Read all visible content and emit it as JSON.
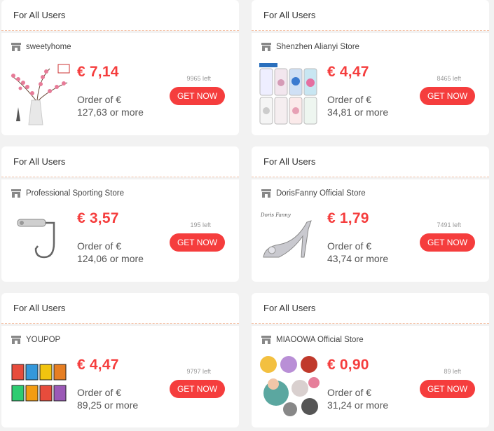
{
  "coupons": [
    {
      "header": "For All Users",
      "store": "sweetyhome",
      "price": "€ 7,14",
      "order_line1": "Order of €",
      "order_line2": "127,63 or more",
      "left": "9965 left",
      "button": "GET NOW",
      "image_icon": "flower-vase-image"
    },
    {
      "header": "For All Users",
      "store": "Shenzhen Alianyi Store",
      "price": "€ 4,47",
      "order_line1": "Order of €",
      "order_line2": "34,81 or more",
      "left": "8465 left",
      "button": "GET NOW",
      "image_icon": "phone-cases-image"
    },
    {
      "header": "For All Users",
      "store": "Professional Sporting Store",
      "price": "€ 3,57",
      "order_line1": "Order of €",
      "order_line2": "124,06 or more",
      "left": "195 left",
      "button": "GET NOW",
      "image_icon": "fishing-hook-image"
    },
    {
      "header": "For All Users",
      "store": "DorisFanny Official Store",
      "price": "€ 1,79",
      "order_line1": "Order of €",
      "order_line2": "43,74 or more",
      "left": "7491 left",
      "button": "GET NOW",
      "image_icon": "high-heel-shoe-image",
      "image_text": "Doris Fanny"
    },
    {
      "header": "For All Users",
      "store": "YOUPOP",
      "price": "€ 4,47",
      "order_line1": "Order of €",
      "order_line2": "89,25 or more",
      "left": "9797 left",
      "button": "GET NOW",
      "image_icon": "pin-badges-image"
    },
    {
      "header": "For All Users",
      "store": "MIAOOWA Official Store",
      "price": "€ 0,90",
      "order_line1": "Order of €",
      "order_line2": "31,24 or more",
      "left": "89 left",
      "button": "GET NOW",
      "image_icon": "baby-seat-image"
    }
  ],
  "colors": {
    "accent": "#f53d3d",
    "background": "#f2f2f2"
  }
}
